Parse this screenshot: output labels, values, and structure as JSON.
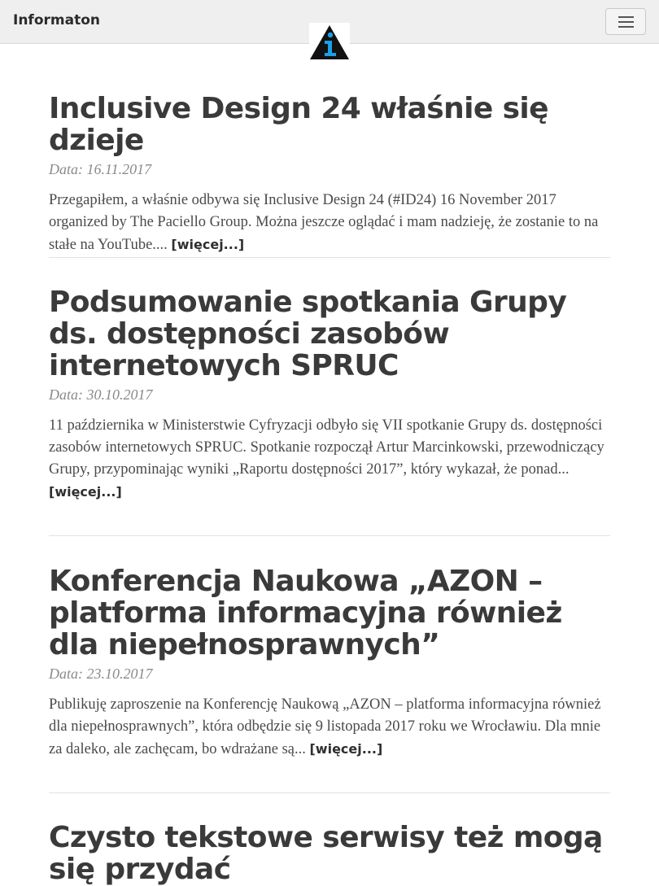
{
  "header": {
    "brand": "Informaton",
    "menu_toggle": "menu"
  },
  "posts": [
    {
      "title": "Inclusive Design 24 właśnie się dzieje",
      "date": "Data: 16.11.2017",
      "excerpt": "Przegapiłem, a właśnie odbywa się Inclusive Design 24 (#ID24) 16 November 2017 organized by The Paciello Group. Można jeszcze oglądać i mam nadzieję, że zostanie to na stałe na YouTube.... ",
      "more": "[więcej...]"
    },
    {
      "title": "Podsumowanie spotkania Grupy ds. dostępności zasobów internetowych SPRUC",
      "date": "Data: 30.10.2017",
      "excerpt": "11 października w Ministerstwie Cyfryzacji odbyło się VII spotkanie Grupy ds. dostępności zasobów internetowych SPRUC. Spotkanie rozpoczął Artur Marcinkowski, przewodniczący Grupy, przypominając wyniki „Raportu dostępności 2017”, który wykazał, że ponad... ",
      "more": "[więcej...]"
    },
    {
      "title": "Konferencja Naukowa „AZON – platforma informacyjna również dla niepełnosprawnych”",
      "date": "Data: 23.10.2017",
      "excerpt": "Publikuję zaproszenie na Konferencję Naukową „AZON – platforma informacyjna również dla niepełnosprawnych”, która odbędzie się 9 listopada 2017 roku we Wrocławiu. Dla mnie za daleko, ale zachęcam, bo wdrażane są... ",
      "more": "[więcej...]"
    },
    {
      "title": "Czysto tekstowe serwisy też mogą się przydać"
    }
  ],
  "colors": {
    "navbar_bg": "#efefef",
    "logo_triangle": "#111111",
    "logo_accent": "#1aa0e6",
    "title": "#3a3a3a",
    "date": "#8a8a8a"
  }
}
